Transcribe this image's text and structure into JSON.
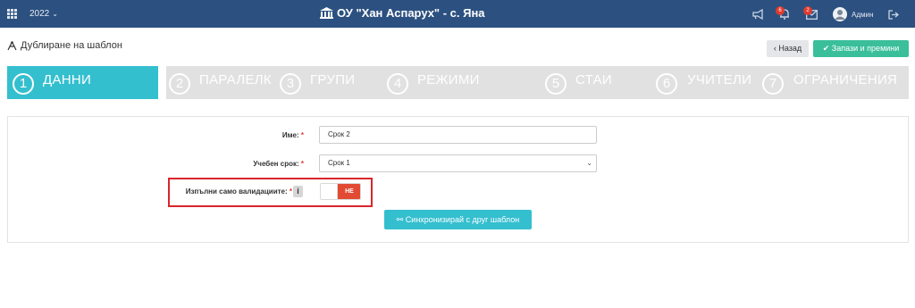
{
  "topbar": {
    "year": "2022",
    "brand_title": "ОУ \"Хан Аспарух\" - с. Яна",
    "notifications_count": "6",
    "messages_count": "2",
    "user_name": "Админ"
  },
  "header": {
    "page_title": "Дублиране на шаблон",
    "back_label": "Назад",
    "save_label": "Запази и премини"
  },
  "steps": [
    {
      "num": "1",
      "label": "ДАННИ",
      "active": true
    },
    {
      "num": "2",
      "label": "ПАРАЛЕЛКИ",
      "active": false
    },
    {
      "num": "3",
      "label": "ГРУПИ",
      "active": false
    },
    {
      "num": "4",
      "label": "РЕЖИМИ",
      "active": false
    },
    {
      "num": "5",
      "label": "СТАИ",
      "active": false
    },
    {
      "num": "6",
      "label": "УЧИТЕЛИ",
      "active": false
    },
    {
      "num": "7",
      "label": "ОГРАНИЧЕНИЯ",
      "active": false
    }
  ],
  "form": {
    "name_label": "Име:",
    "name_value": "Срок 2",
    "term_label": "Учебен срок:",
    "term_value": "Срок 1",
    "validations_label": "Изпълни само валидациите:",
    "info_glyph": "i",
    "toggle_value": "НЕ",
    "required_mark": "*",
    "sync_label": "Синхронизирай с друг шаблон"
  },
  "colors": {
    "topbar": "#2c5180",
    "accent_teal": "#34bfcf",
    "save_green": "#3bbf9b",
    "toggle_red": "#e24a33",
    "highlight_red": "#d9262b"
  }
}
